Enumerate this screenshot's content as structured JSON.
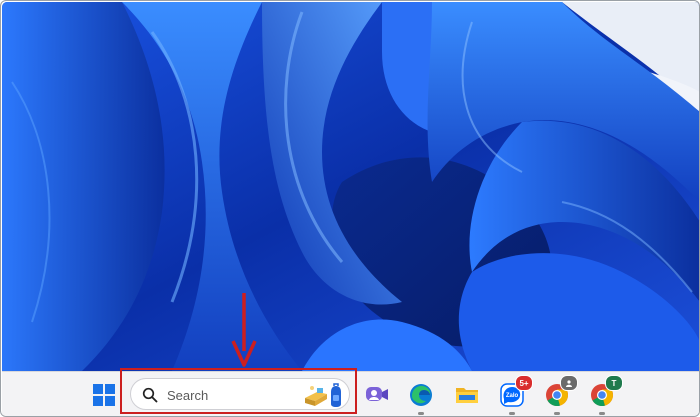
{
  "taskbar": {
    "search": {
      "placeholder": "Search"
    },
    "badges": {
      "zalo": "5+",
      "chrome_profile_2": "T"
    },
    "icons": [
      "windows-start-icon",
      "search-icon",
      "meet-now-icon",
      "edge-icon",
      "file-explorer-icon",
      "zalo-icon",
      "chrome-icon",
      "chrome-profile-icon"
    ]
  },
  "annotation": {
    "color": "#cc1f1f"
  },
  "colors": {
    "wallpaper_base": "#1747d6",
    "taskbar_bg": "#f3f3f5"
  }
}
